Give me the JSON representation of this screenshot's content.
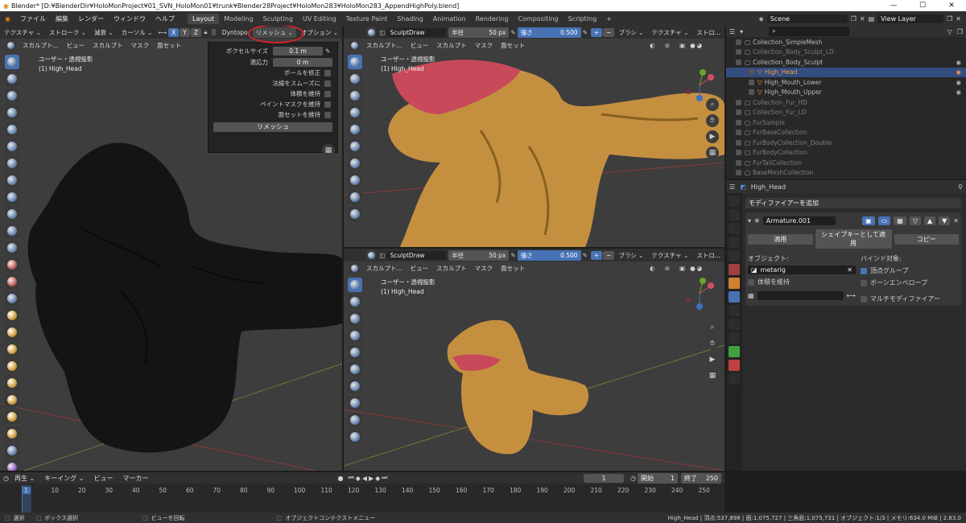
{
  "window": {
    "title": "Blender* [D:¥BlenderDir¥HoloMonProject¥01_SVN_HoloMon01¥trunk¥Blender28Project¥HoloMon283¥HoloMon283_AppendHighPoly.blend]",
    "min": "—",
    "max": "☐",
    "close": "✕"
  },
  "menu": [
    "ファイル",
    "編集",
    "レンダー",
    "ウィンドウ",
    "ヘルプ"
  ],
  "workspaces": [
    "Layout",
    "Modeling",
    "Sculpting",
    "UV Editing",
    "Texture Paint",
    "Shading",
    "Animation",
    "Rendering",
    "Compositing",
    "Scripting"
  ],
  "workspace_add": "+",
  "scene": "Scene",
  "view_layer": "View Layer",
  "left_header": {
    "items": [
      "テクスチャ ⌄",
      "ストローク ⌄",
      "減衰 ⌄",
      "カーソル ⌄"
    ],
    "axes": [
      "X",
      "Y",
      "Z"
    ],
    "dyntopo": "Dyntopo",
    "remesh": "リメッシュ ⌄",
    "options": "オプション ⌄"
  },
  "left_header2": [
    "スカルプト...",
    "ビュー",
    "スカルプト",
    "マスク",
    "面セット"
  ],
  "left_view": {
    "label": "ユーザー・透視投影",
    "object": "(1) High_Head"
  },
  "remesh_popup": {
    "voxel_label": "ボクセルサイズ",
    "voxel_value": "0.1 m",
    "adapt_label": "適応力",
    "adapt_value": "0 m",
    "checks": [
      "ボールを修正",
      "法線をスムーズに",
      "体積を維持",
      "ペイントマスクを維持",
      "面セットを維持"
    ],
    "button": "リメッシュ"
  },
  "right_header": {
    "brush": "SculptDraw",
    "radius_label": "半径",
    "radius_value": "50 px",
    "strength_label": "強さ",
    "strength_value": "0.500",
    "brush_menu": "ブラシ ⌄",
    "tex_menu": "テクスチャ ⌄",
    "stroke_menu": "ストロ..."
  },
  "right_header2": [
    "スカルプト...",
    "ビュー",
    "スカルプト",
    "マスク",
    "面セット"
  ],
  "top_view": {
    "label": "ユーザー・透視投影",
    "object": "(1) High_Head"
  },
  "bot_view": {
    "label": "ユーザー・透視投影",
    "object": "(1) High_Head"
  },
  "outliner": [
    {
      "name": "Collection_SimpleMesh",
      "dim": false,
      "sel": false,
      "eye": false,
      "indent": 0
    },
    {
      "name": "Collection_Body_Sculpt_LD",
      "dim": true,
      "sel": false,
      "eye": false,
      "indent": 0
    },
    {
      "name": "Collection_Body_Sculpt",
      "dim": false,
      "sel": false,
      "eye": true,
      "indent": 0
    },
    {
      "name": "High_Head",
      "dim": false,
      "sel": true,
      "eye": true,
      "indent": 1
    },
    {
      "name": "High_Mouth_Lower",
      "dim": false,
      "sel": false,
      "eye": true,
      "indent": 1
    },
    {
      "name": "High_Mouth_Upper",
      "dim": false,
      "sel": false,
      "eye": true,
      "indent": 1
    },
    {
      "name": "Collection_Fur_HD",
      "dim": true,
      "sel": false,
      "eye": false,
      "indent": 0
    },
    {
      "name": "Collection_Fur_LD",
      "dim": true,
      "sel": false,
      "eye": false,
      "indent": 0
    },
    {
      "name": "FurSample",
      "dim": true,
      "sel": false,
      "eye": false,
      "indent": 0
    },
    {
      "name": "FurBaseCollection",
      "dim": true,
      "sel": false,
      "eye": false,
      "indent": 0
    },
    {
      "name": "FurBodyCollection_Double",
      "dim": true,
      "sel": false,
      "eye": false,
      "indent": 0
    },
    {
      "name": "FurBodyCollection",
      "dim": true,
      "sel": false,
      "eye": false,
      "indent": 0
    },
    {
      "name": "FurTailCollection",
      "dim": true,
      "sel": false,
      "eye": false,
      "indent": 0
    },
    {
      "name": "BaseMeshCollection",
      "dim": true,
      "sel": false,
      "eye": false,
      "indent": 0
    }
  ],
  "properties": {
    "object": "High_Head",
    "add_modifier": "モディファイアーを追加",
    "modifier_name": "Armature.001",
    "apply": "適用",
    "apply_shape": "シェイプキーとして適用",
    "copy": "コピー",
    "object_label": "オブジェクト:",
    "object_value": "metarig",
    "bind_label": "バインド対象:",
    "vertex_groups": "頂点グループ",
    "bone_envelopes": "ボーンエンベロープ",
    "preserve_volume": "体積を維持",
    "multi_modifier": "マルチモディファイアー"
  },
  "timeline": {
    "menu": [
      "再生 ⌄",
      "キーイング ⌄",
      "ビュー",
      "マーカー"
    ],
    "current": "1",
    "start_label": "開始",
    "start": "1",
    "end_label": "終了",
    "end": "250",
    "ticks": [
      "1",
      "10",
      "20",
      "30",
      "40",
      "50",
      "60",
      "70",
      "80",
      "90",
      "100",
      "110",
      "120",
      "130",
      "140",
      "150",
      "160",
      "170",
      "180",
      "190",
      "200",
      "210",
      "220",
      "230",
      "240",
      "250"
    ]
  },
  "status": {
    "select": "選択",
    "box_select": "ボックス選択",
    "rotate": "ビューを回転",
    "context": "オブジェクトコンテクストメニュー",
    "stats": "High_Head | 頂点:537,898 | 面:1,075,727 | 三角面:1,075,731 | オブジェクト:1/3 | メモリ:634.0 MiB | 2.83.0"
  },
  "colors": {
    "accent": "#4772b3",
    "annotation": "#d8222a",
    "sculpt": "#c49040",
    "dark_mesh": "#141414"
  }
}
